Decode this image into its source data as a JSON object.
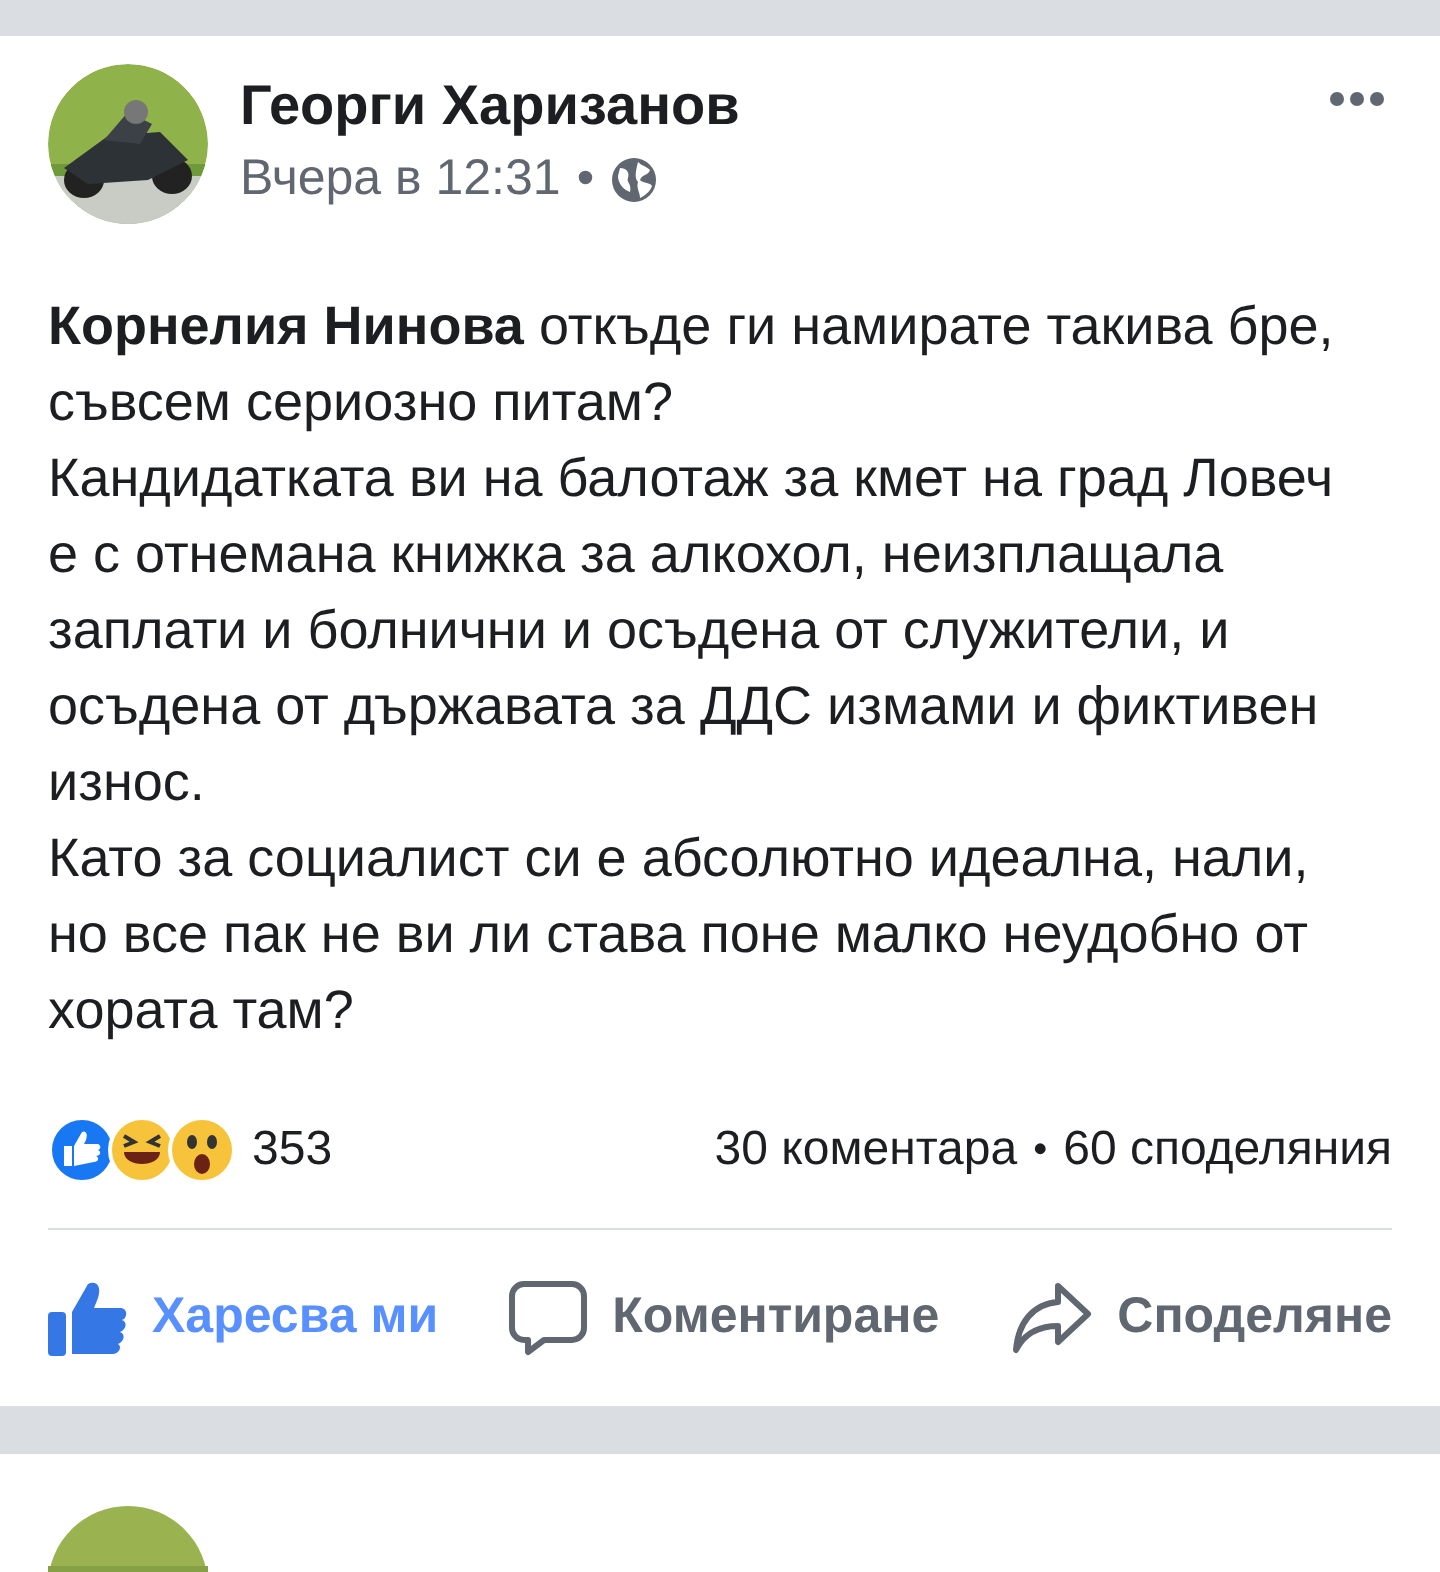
{
  "post": {
    "author": "Георги Харизанов",
    "time": "Вчера в 12:31",
    "separator": "•",
    "paragraphs": [
      "**Корнелия Нинова** откъде ги намирате такива бре, съвсем сериозно питам?",
      "Кандидатката ви на балотаж за кмет на град Ловеч е с отнемана книжка за алкохол, неизплащала заплати и болнични и осъдена от служители, и осъдена от държавата за ДДС измами и фиктивен износ.",
      "Като за социалист си е абсолютно идеална, нали, но все пак не ви ли става поне малко неудобно от хората там?"
    ],
    "reaction_count": "353",
    "comments": "30 коментара",
    "stats_separator": "•",
    "shares": "60 споделяния",
    "actions": [
      {
        "kind": "like",
        "label": "Харесва ми",
        "selected": true
      },
      {
        "kind": "comment",
        "label": "Коментиране",
        "selected": false
      },
      {
        "kind": "share",
        "label": "Споделяне",
        "selected": false
      }
    ]
  }
}
